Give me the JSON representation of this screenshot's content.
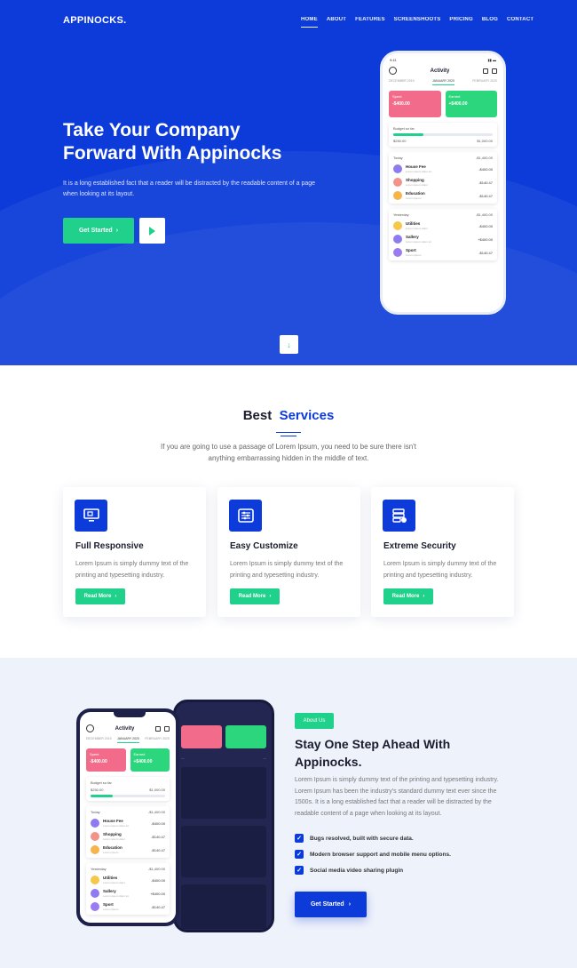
{
  "nav": {
    "logo": "APPINOCKS.",
    "items": [
      "HOME",
      "ABOUT",
      "FEATURES",
      "SCREENSHOOTS",
      "PRICING",
      "BLOG",
      "CONTACT"
    ]
  },
  "hero": {
    "title_line1": "Take Your Company",
    "title_line2": "Forward With Appinocks",
    "text": "It is a long established fact that a reader will be distracted by the readable content of a page when looking at its layout.",
    "cta": "Get Started",
    "cta_arrow": "›",
    "scroll": "↓"
  },
  "phone": {
    "time": "9:41",
    "title": "Activity",
    "tabs": [
      "DECEMBER 2019",
      "JANUARY 2020",
      "FEBRUARY 2020"
    ],
    "card1_label": "Spent",
    "card1_value": "-$400.00",
    "card2_label": "Earned",
    "card2_value": "+$400.00",
    "budget_label": "Budget so far",
    "budget_left": "$250.00",
    "budget_right": "$1,000.00",
    "budget_fill": 0.3,
    "today_label": "Today",
    "today_total": "-$1,400.00",
    "today_items": [
      {
        "name": "House Fee",
        "sub": "Lorem ipsum dolor sit",
        "amount": "-$400.00",
        "color": "#8e7bf0"
      },
      {
        "name": "Shopping",
        "sub": "Lorem ipsum dolor",
        "amount": "-$140.47",
        "color": "#f2938b"
      },
      {
        "name": "Education",
        "sub": "Lorem ipsum",
        "amount": "-$140.47",
        "color": "#f5b54a"
      }
    ],
    "yesterday_label": "Yesterday",
    "yesterday_total": "-$1,400.00",
    "yesterday_items": [
      {
        "name": "Utilities",
        "sub": "Lorem ipsum dolor",
        "amount": "-$400.00",
        "color": "#f5c84a"
      },
      {
        "name": "Sallery",
        "sub": "Lorem ipsum dolor sit",
        "amount": "+$400.00",
        "color": "#8e7bf0"
      },
      {
        "name": "Sport",
        "sub": "Lorem ipsum",
        "amount": "-$140.47",
        "color": "#9a7bf0"
      }
    ]
  },
  "services": {
    "title_a": "Best",
    "title_b": "Services",
    "subtitle": "If you are going to use a passage of Lorem Ipsum, you need to be sure there isn't anything embarrassing hidden in the middle of text.",
    "cards": [
      {
        "title": "Full Responsive",
        "text": "Lorem Ipsum is simply dummy text of the printing and typesetting industry.",
        "button": "Read More",
        "icon": "monitor-icon"
      },
      {
        "title": "Easy Customize",
        "text": "Lorem Ipsum is simply dummy text of the printing and typesetting industry.",
        "button": "Read More",
        "icon": "sliders-icon"
      },
      {
        "title": "Extreme Security",
        "text": "Lorem Ipsum is simply dummy text of the printing and typesetting industry.",
        "button": "Read More",
        "icon": "server-lock-icon"
      }
    ]
  },
  "about": {
    "badge": "About Us",
    "title": "Stay One Step Ahead With Appinocks.",
    "text": "Lorem Ipsum is simply dummy text of the printing and typesetting industry. Lorem Ipsum has been the industry's standard dummy text ever since the 1500s. It is a long established fact that a reader will be distracted by the readable content of a page when looking at its layout.",
    "checks": [
      "Bugs resolved, built with secure data.",
      "Modern browser support and mobile menu options.",
      "Social media video sharing plugin"
    ],
    "cta": "Get Started",
    "cta_arrow": "›"
  },
  "colors": {
    "primary": "#0c3bd9",
    "accent": "#1fd18b"
  }
}
